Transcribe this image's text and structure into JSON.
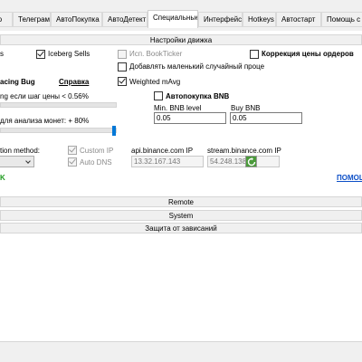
{
  "tabs": [
    "ьтер",
    "Телеграм",
    "АвтоПокупка",
    "АвтоДетект",
    "Специальные",
    "Интерфейс",
    "Hotkeys",
    "Автостарт",
    "Помощь с нас"
  ],
  "section_header": "Настройки движка",
  "checks": {
    "sells_suffix": "s",
    "iceberg_sells": "Iceberg Sells",
    "bookticker": "Исп. BookTicker",
    "order_price_correction": "Коррекция цены ордеров",
    "random_price": "Добавлять маленький случайный проце",
    "weighted_mavg": "Weighted mAvg",
    "auto_bnb": "Автопокупка BNB",
    "custom_ip": "Custom IP",
    "auto_dns": "Auto DNS"
  },
  "labels": {
    "spacing_bug": "acing Bug",
    "help_link": "Справка",
    "price_step": "ng если шаг цены < 0.56%",
    "coin_analysis": "для анализа монет: + 80%",
    "min_bnb": "Min. BNB level",
    "buy_bnb": "Buy BNB",
    "connection_method": "tion method:",
    "api_ip_label": "api.binance.com IP",
    "stream_ip_label": "stream.binance.com IP",
    "ok_link": "K",
    "help_link2": "ПОМОЩ"
  },
  "values": {
    "price_step_level": 0,
    "coin_analysis_level": 1,
    "min_bnb": "0.05",
    "buy_bnb": "0.05",
    "api_ip": "13.32.167.143",
    "stream_ip": "54.248.138.15"
  },
  "sections": [
    "Remote",
    "System",
    "Защита от зависаний"
  ],
  "colors": {
    "accent": "#0078d7",
    "ok_green": "#1e9b1e",
    "link_blue": "#0c4fc7"
  },
  "icons": {
    "refresh": "refresh-icon"
  }
}
